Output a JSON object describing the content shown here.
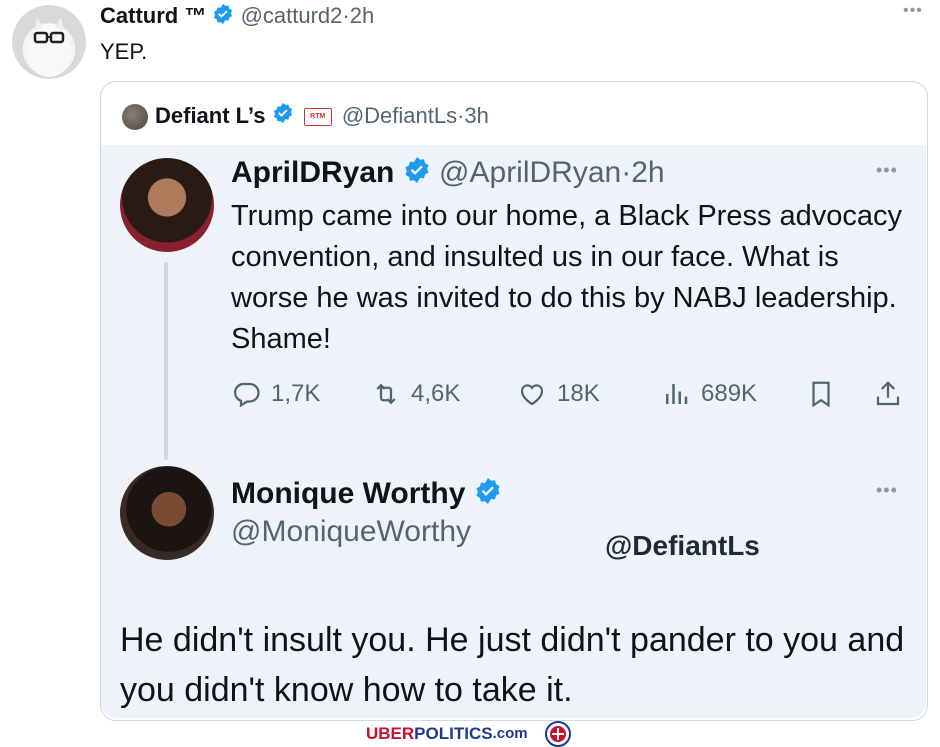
{
  "outer": {
    "name": "Catturd ™",
    "handle": "@catturd2",
    "time": "2h",
    "text": "YEP."
  },
  "quote": {
    "name": "Defiant L’s",
    "badge": "RTM",
    "handle": "@DefiantLs",
    "time": "3h"
  },
  "april": {
    "name": "AprilDRyan",
    "handle": "@AprilDRyan",
    "time": "2h",
    "text": "Trump came into our home, a Black Press advocacy convention, and insulted us in our face. What is worse he was invited to do this by NABJ leadership. Shame!",
    "replies": "1,7K",
    "reposts": "4,6K",
    "likes": "18K",
    "views": "689K"
  },
  "monique": {
    "name": "Monique Worthy",
    "handle": "@MoniqueWorthy",
    "text": "He didn't insult you. He just didn't pander to you and you didn't know how to take it."
  },
  "watermark": "@DefiantLs",
  "footer": {
    "uber": "UBER",
    "politics": "POLITICS",
    "com": ".com"
  },
  "colors": {
    "verified": "#1d9bf0",
    "thread_bg": "#eef3fa",
    "uber_red": "#c8102e",
    "politics_blue": "#1b3a8a"
  },
  "icons": [
    "verified-icon",
    "more-icon",
    "reply-icon",
    "repost-icon",
    "like-icon",
    "views-icon",
    "bookmark-icon",
    "share-icon"
  ]
}
